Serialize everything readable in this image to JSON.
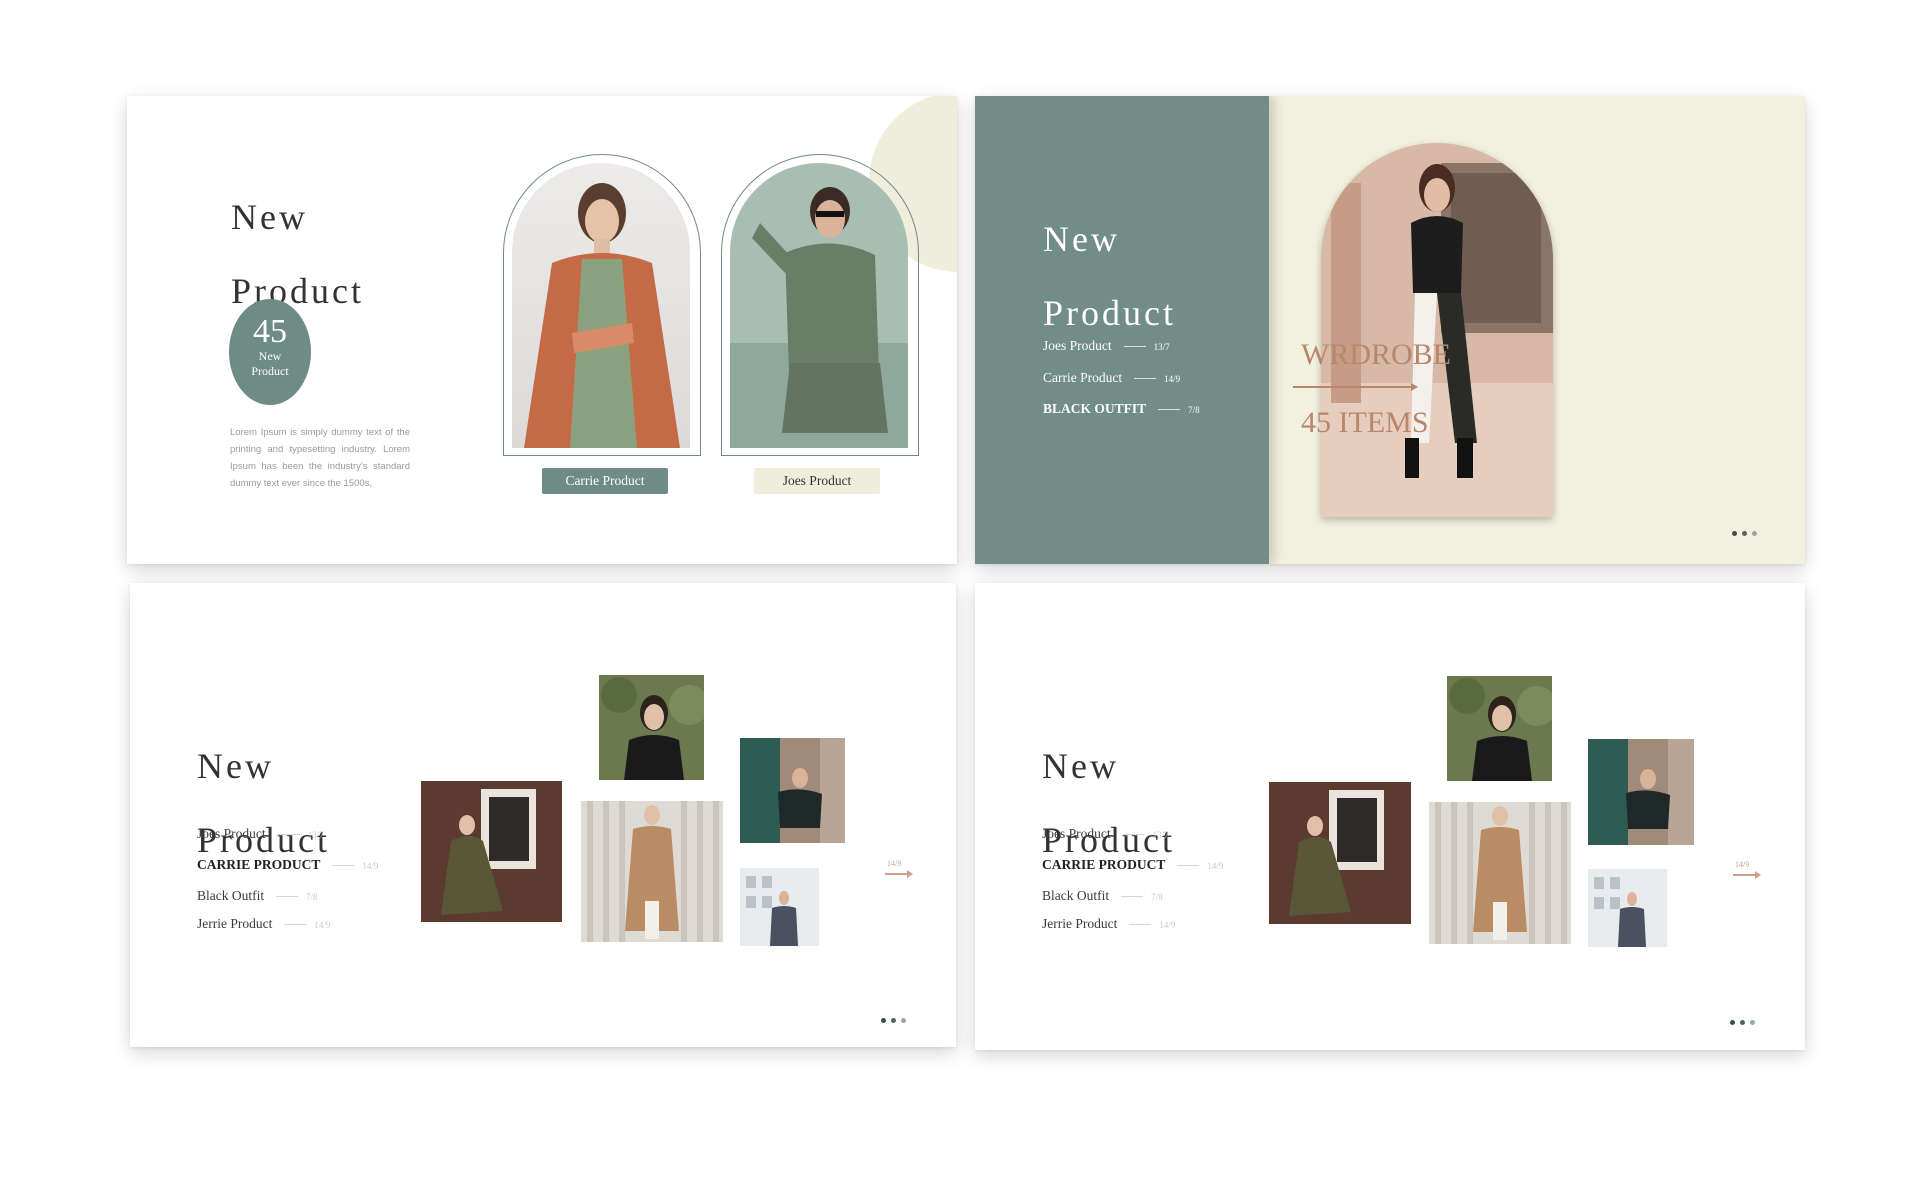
{
  "colors": {
    "sage": "#6f8b85",
    "sage_panel": "#728c87",
    "cream": "#f2f0de",
    "accent_terracotta": "#b8866a",
    "text_dark": "#333333",
    "text_muted": "#9a9a9a"
  },
  "slide1": {
    "title_line1": "New",
    "title_line2": "Product",
    "badge_number": "45",
    "badge_line1": "New",
    "badge_line2": "Product",
    "body_text": "Lorem Ipsum is simply dummy text of the printing and typesetting industry. Lorem Ipsum has been the industry's standard dummy text ever since the 1500s,",
    "photo_left_label": "Carrie Product",
    "photo_right_label": "Joes Product"
  },
  "slide2": {
    "title_line1": "New",
    "title_line2": "Product",
    "list": [
      {
        "label": "Joes Product",
        "date": "13/7"
      },
      {
        "label": "Carrie Product",
        "date": "14/9"
      },
      {
        "label": "BLACK OUTFIT",
        "date": "7/8"
      }
    ],
    "headline_line1": "WRDROBE",
    "headline_line2": "45 ITEMS"
  },
  "slide3": {
    "title_line1": "New",
    "title_line2": "Product",
    "list": [
      {
        "label": "Joes Product",
        "date": "13/7"
      },
      {
        "label": "CARRIE PRODUCT",
        "date": "14/9"
      },
      {
        "label": "Black Outfit",
        "date": "7/8"
      },
      {
        "label": "Jerrie Product",
        "date": "14/9"
      }
    ],
    "next_label": "14/9"
  },
  "slide4": {
    "title_line1": "New",
    "title_line2": "Product",
    "list": [
      {
        "label": "Joes Product",
        "date": "13/7"
      },
      {
        "label": "CARRIE PRODUCT",
        "date": "14/9"
      },
      {
        "label": "Black Outfit",
        "date": "7/8"
      },
      {
        "label": "Jerrie Product",
        "date": "14/9"
      }
    ],
    "next_label": "14/9"
  }
}
